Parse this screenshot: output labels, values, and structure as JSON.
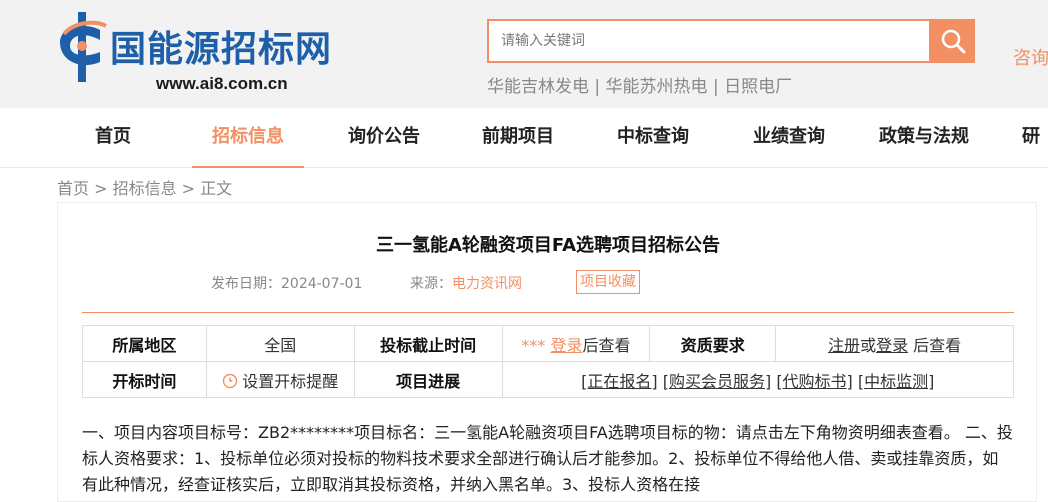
{
  "header": {
    "logo_text": "国能源招标网",
    "logo_url": "www.ai8.com.cn",
    "search_placeholder": "请输入关键词",
    "hot_links": [
      "华能吉林发电",
      "华能苏州热电",
      "日照电厂"
    ],
    "hot_separator": " | ",
    "consult_label": "咨询"
  },
  "nav": {
    "items": [
      "首页",
      "招标信息",
      "询价公告",
      "前期项目",
      "中标查询",
      "业绩查询",
      "政策与法规",
      "研"
    ],
    "active_index": 1
  },
  "breadcrumb": "首页 > 招标信息 > 正文",
  "article": {
    "title": "三一氢能A轮融资项目FA选聘项目招标公告",
    "date_label": "发布日期：",
    "date": "2024-07-01",
    "source_label": "来源：",
    "source": "电力资讯网",
    "favorite_label": "项目收藏"
  },
  "info_table": {
    "region_label": "所属地区",
    "region_value": "全国",
    "deadline_label": "投标截止时间",
    "deadline_stars": "***",
    "deadline_login": "登录",
    "deadline_after": "后查看",
    "qualification_label": "资质要求",
    "qual_register": "注册",
    "qual_or": "或",
    "qual_login": "登录",
    "qual_after": " 后查看",
    "open_time_label": "开标时间",
    "open_time_action": "设置开标提醒",
    "progress_label": "项目进展",
    "progress_links": [
      "[正在报名]",
      "[购买会员服务]",
      "[代购标书]",
      "[中标监测]"
    ]
  },
  "body_text": "一、项目内容项目标号：ZB2********项目标名：三一氢能A轮融资项目FA选聘项目标的物：请点击左下角物资明细表查看。 二、投标人资格要求：1、投标单位必须对投标的物料技术要求全部进行确认后才能参加。2、投标单位不得给他人借、卖或挂靠资质，如有此种情况，经查证核实后，立即取消其投标资格，并纳入黑名单。3、投标人资格在接",
  "colors": {
    "accent": "#f39063",
    "logo_blue": "#1d5fa8"
  },
  "icons": [
    "search-icon",
    "clock-icon",
    "logo-mark-icon"
  ]
}
